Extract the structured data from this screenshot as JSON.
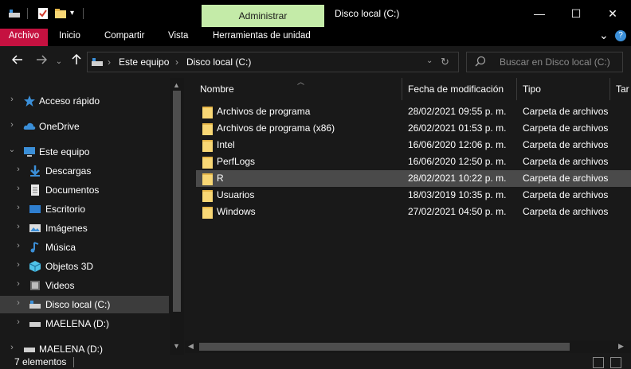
{
  "window": {
    "title": "Disco local (C:)",
    "context_tab": "Administrar",
    "minimize_glyph": "—",
    "maximize_glyph": "☐",
    "close_glyph": "✕"
  },
  "ribbon": {
    "tabs": [
      "Archivo",
      "Inicio",
      "Compartir",
      "Vista",
      "Herramientas de unidad"
    ],
    "expand_glyph": "⌄",
    "help_glyph": "?"
  },
  "address": {
    "crumbs": [
      "Este equipo",
      "Disco local (C:)"
    ],
    "separator": "›",
    "search_placeholder": "Buscar en Disco local (C:)"
  },
  "nav": {
    "items": [
      {
        "label": "Acceso rápido",
        "icon": "star-icon"
      },
      {
        "label": "OneDrive",
        "icon": "cloud-icon"
      },
      {
        "label": "Este equipo",
        "icon": "computer-icon"
      },
      {
        "label": "Descargas",
        "icon": "download-icon"
      },
      {
        "label": "Documentos",
        "icon": "document-icon"
      },
      {
        "label": "Escritorio",
        "icon": "desktop-icon"
      },
      {
        "label": "Imágenes",
        "icon": "pictures-icon"
      },
      {
        "label": "Música",
        "icon": "music-icon"
      },
      {
        "label": "Objetos 3D",
        "icon": "cube-icon"
      },
      {
        "label": "Videos",
        "icon": "video-icon"
      },
      {
        "label": "Disco local (C:)",
        "icon": "drive-icon"
      },
      {
        "label": "MAELENA (D:)",
        "icon": "drive-icon"
      },
      {
        "label": "MAELENA (D:)",
        "icon": "drive-icon"
      }
    ]
  },
  "list": {
    "columns": [
      "Nombre",
      "Fecha de modificación",
      "Tipo",
      "Tar"
    ],
    "rows": [
      {
        "name": "Archivos de programa",
        "date": "28/02/2021 09:55 p. m.",
        "type": "Carpeta de archivos"
      },
      {
        "name": "Archivos de programa (x86)",
        "date": "26/02/2021 01:53 p. m.",
        "type": "Carpeta de archivos"
      },
      {
        "name": "Intel",
        "date": "16/06/2020 12:06 p. m.",
        "type": "Carpeta de archivos"
      },
      {
        "name": "PerfLogs",
        "date": "16/06/2020 12:50 p. m.",
        "type": "Carpeta de archivos"
      },
      {
        "name": "R",
        "date": "28/02/2021 10:22 p. m.",
        "type": "Carpeta de archivos"
      },
      {
        "name": "Usuarios",
        "date": "18/03/2019 10:35 p. m.",
        "type": "Carpeta de archivos"
      },
      {
        "name": "Windows",
        "date": "27/02/2021 04:50 p. m.",
        "type": "Carpeta de archivos"
      }
    ]
  },
  "status": {
    "count_text": "7 elementos"
  },
  "colors": {
    "file_tab": "#c51140",
    "context_tab": "#c4eba8",
    "folder": "#f8d775",
    "background": "#191919"
  }
}
